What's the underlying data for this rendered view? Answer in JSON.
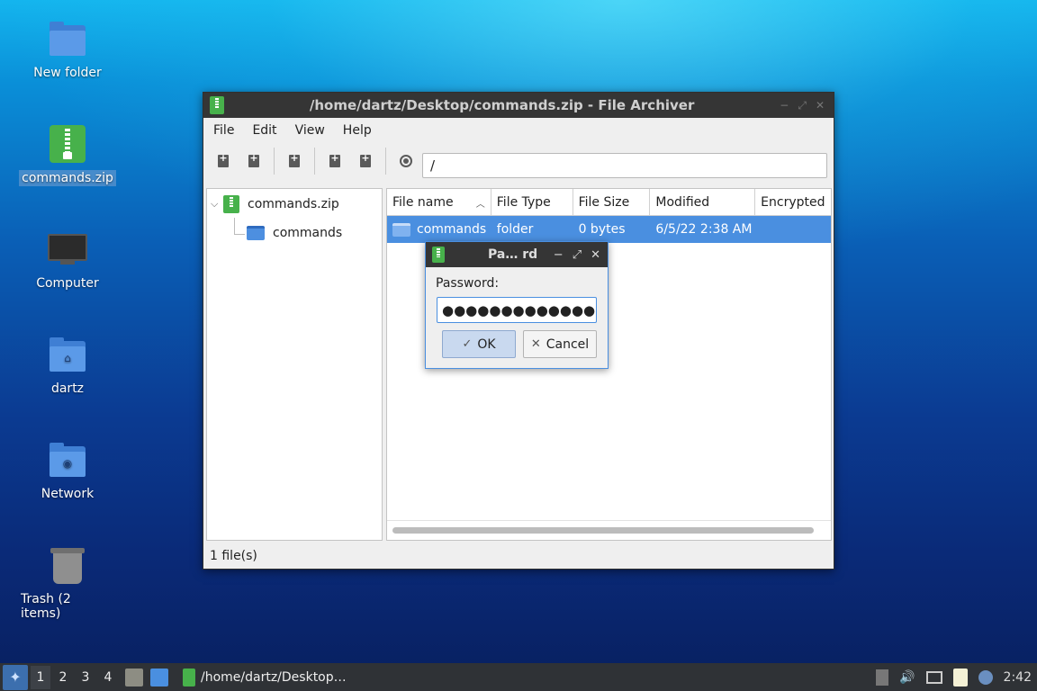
{
  "desktop": {
    "icons": [
      {
        "label": "New folder"
      },
      {
        "label": "commands.zip"
      },
      {
        "label": "Computer"
      },
      {
        "label": "dartz"
      },
      {
        "label": "Network"
      },
      {
        "label": "Trash (2 items)"
      }
    ]
  },
  "window": {
    "title": "/home/dartz/Desktop/commands.zip - File Archiver",
    "menu": [
      "File",
      "Edit",
      "View",
      "Help"
    ],
    "location": "/",
    "tree": {
      "root": "commands.zip",
      "child": "commands"
    },
    "columns": [
      "File name",
      "File Type",
      "File Size",
      "Modified",
      "Encrypted"
    ],
    "rows": [
      {
        "name": "commands",
        "type": "folder",
        "size": "0 bytes",
        "modified": "6/5/22 2:38 AM",
        "encrypted": ""
      }
    ],
    "status": "1 file(s)"
  },
  "dialog": {
    "title": "Pa… rd",
    "label": "Password:",
    "value": "●●●●●●●●●●●●●",
    "ok": "OK",
    "cancel": "Cancel"
  },
  "taskbar": {
    "workspaces": [
      "1",
      "2",
      "3",
      "4"
    ],
    "task": "/home/dartz/Desktop…",
    "clock": "2:42"
  },
  "colors": {
    "selection": "#4a8fe0",
    "titlebar": "#353535",
    "zip_green": "#47b14b"
  }
}
